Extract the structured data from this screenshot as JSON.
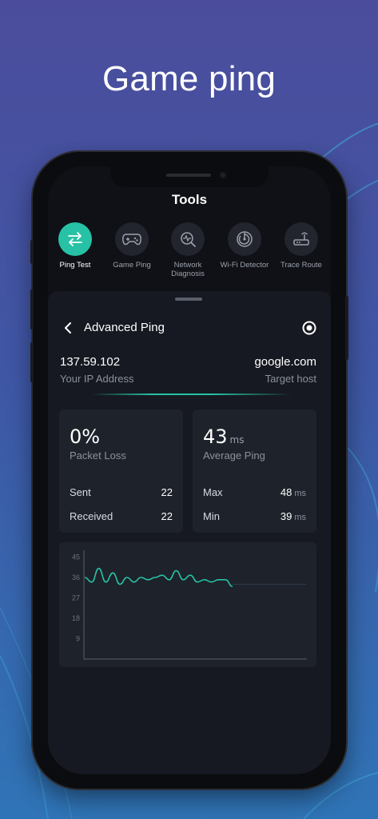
{
  "headline": "Game ping",
  "app": {
    "title": "Tools",
    "tools": [
      {
        "label": "Ping Test",
        "icon": "transfer-arrows-icon",
        "active": true
      },
      {
        "label": "Game Ping",
        "icon": "gamepad-icon",
        "active": false
      },
      {
        "label": "Network Diagnosis",
        "icon": "pulse-search-icon",
        "active": false
      },
      {
        "label": "Wi-Fi Detector",
        "icon": "radar-icon",
        "active": false
      },
      {
        "label": "Trace Route",
        "icon": "router-icon",
        "active": false
      }
    ],
    "colors": {
      "accent": "#27c2a5",
      "sheet": "#161921",
      "card": "#1e222b"
    }
  },
  "sheet": {
    "title": "Advanced Ping",
    "ip_value": "137.59.102",
    "ip_label": "Your IP Address",
    "host_value": "google.com",
    "host_label": "Target host",
    "packet_loss": {
      "value": "0%",
      "label": "Packet Loss",
      "sent_label": "Sent",
      "sent": "22",
      "received_label": "Received",
      "received": "22"
    },
    "average_ping": {
      "value": "43",
      "unit": "ms",
      "label": "Average Ping",
      "max_label": "Max",
      "max": "48",
      "min_label": "Min",
      "min": "39"
    }
  },
  "chart_data": {
    "type": "line",
    "title": "",
    "xlabel": "",
    "ylabel": "",
    "ylim": [
      0,
      48
    ],
    "yticks": [
      9,
      18,
      27,
      36,
      45
    ],
    "x": [
      1,
      2,
      3,
      4,
      5,
      6,
      7,
      8,
      9,
      10,
      11,
      12,
      13,
      14,
      15,
      16,
      17,
      18,
      19,
      20,
      21,
      22
    ],
    "series": [
      {
        "values": [
          36,
          34,
          40,
          34,
          38,
          33,
          36,
          34,
          36,
          35,
          36,
          37,
          35,
          39,
          35,
          37,
          34,
          35,
          34,
          35,
          35,
          32
        ]
      }
    ],
    "baseline": 33,
    "grid": false
  }
}
